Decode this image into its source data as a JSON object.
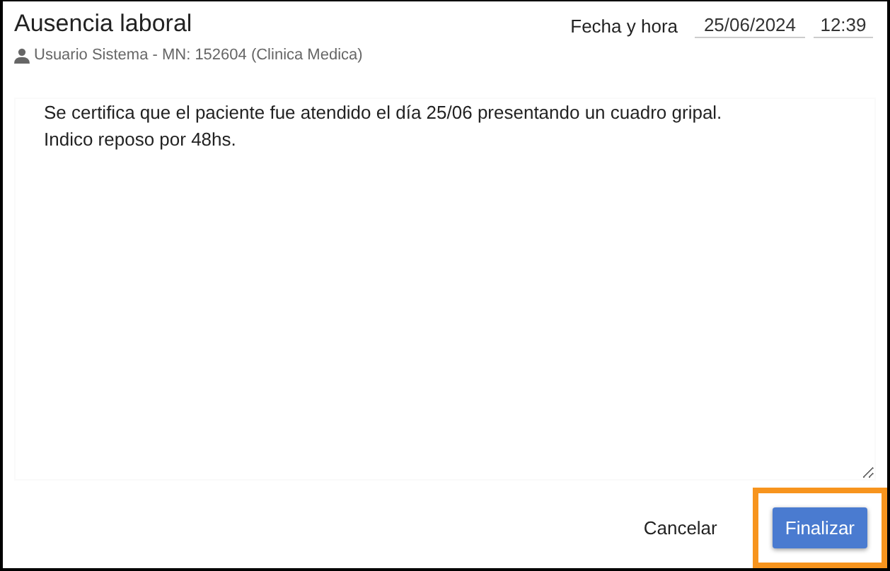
{
  "title": "Ausencia laboral",
  "author": "Usuario Sistema - MN: 152604 (Clinica Medica)",
  "datetime": {
    "label": "Fecha y hora",
    "date": "25/06/2024",
    "time": "12:39"
  },
  "note": {
    "value": "Se certifica que el paciente fue atendido el día 25/06 presentando un cuadro gripal.\nIndico reposo por 48hs."
  },
  "buttons": [
    {
      "label": "Cancelar",
      "kind": "flat",
      "highlighted": false
    },
    {
      "label": "Finalizar",
      "kind": "primary",
      "highlighted": true
    }
  ]
}
